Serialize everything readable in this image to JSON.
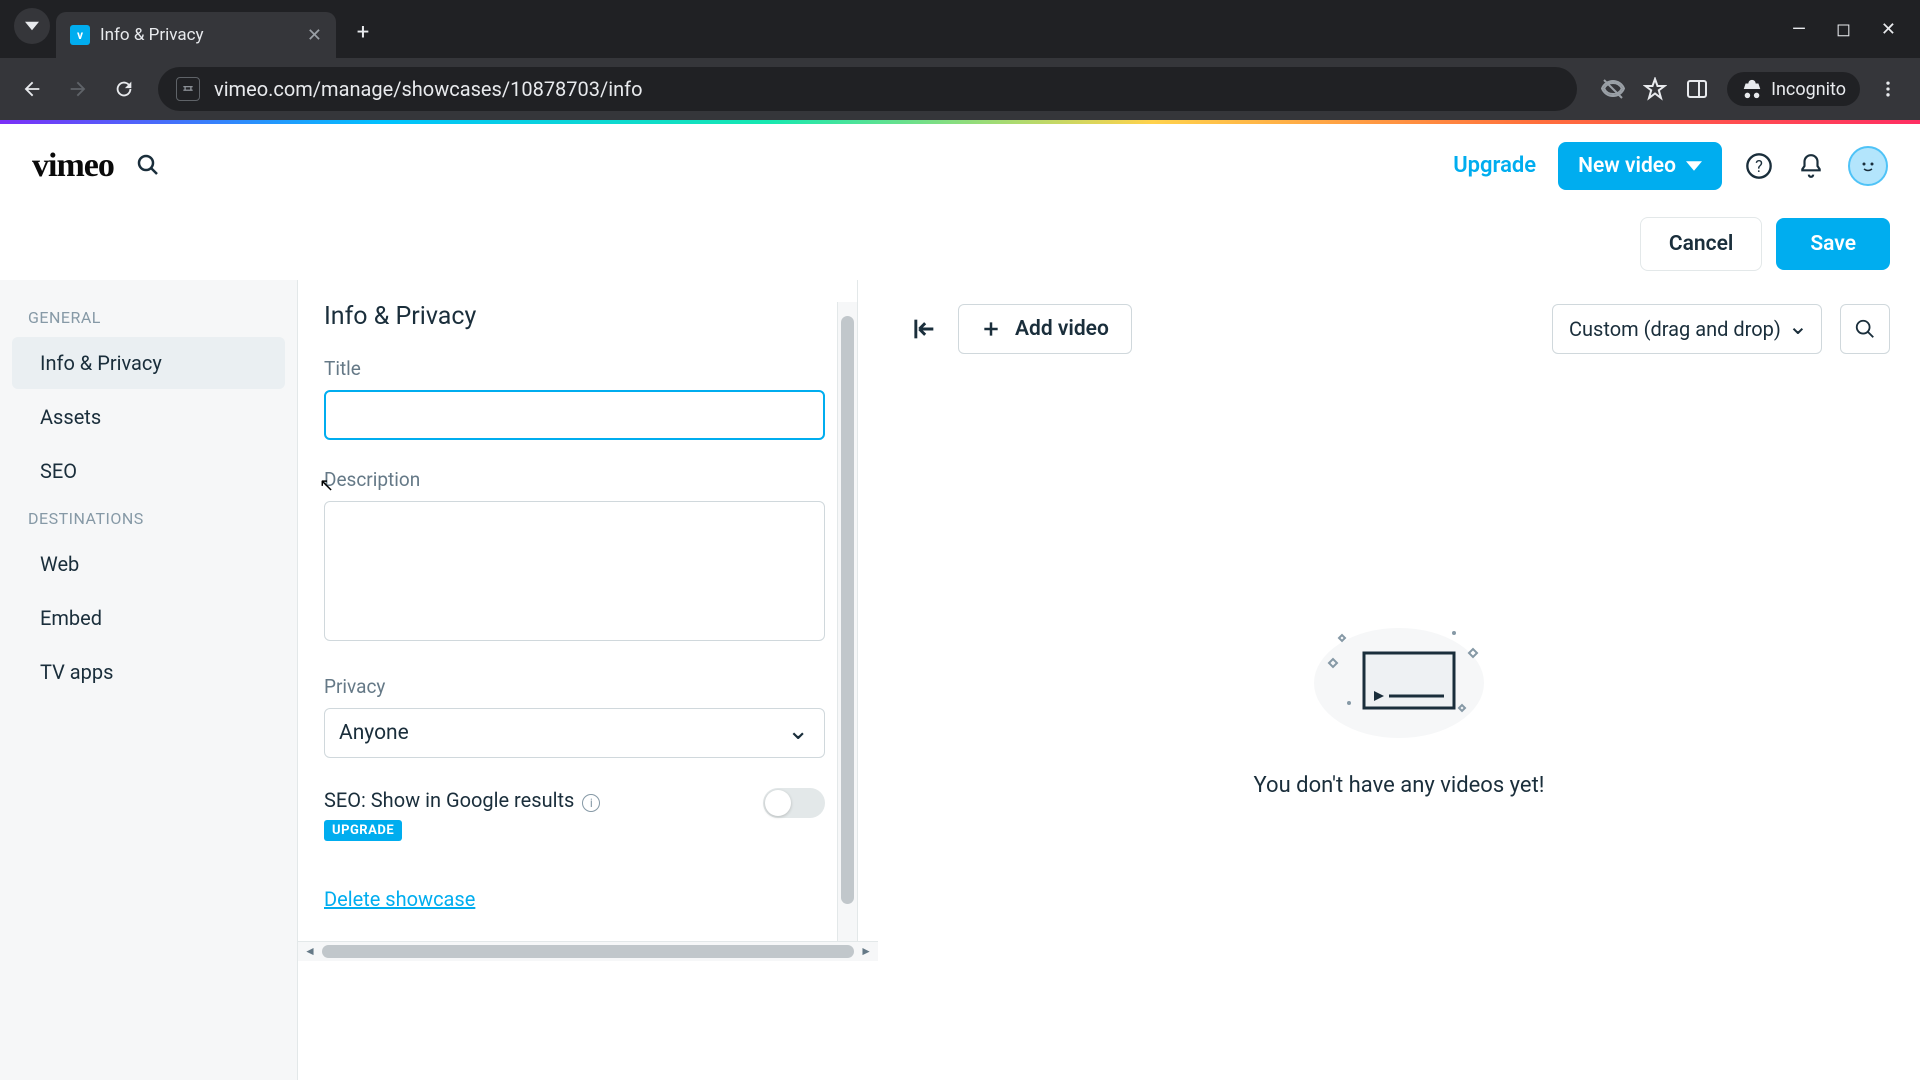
{
  "browser": {
    "tab_title": "Info & Privacy",
    "url": "vimeo.com/manage/showcases/10878703/info",
    "incognito_label": "Incognito"
  },
  "header": {
    "logo_text": "vimeo",
    "upgrade": "Upgrade",
    "new_video": "New video"
  },
  "actionbar": {
    "cancel": "Cancel",
    "save": "Save"
  },
  "sidebar": {
    "general_label": "GENERAL",
    "destinations_label": "DESTINATIONS",
    "items": {
      "info_privacy": "Info & Privacy",
      "assets": "Assets",
      "seo": "SEO",
      "web": "Web",
      "embed": "Embed",
      "tv_apps": "TV apps"
    }
  },
  "form": {
    "heading": "Info & Privacy",
    "title_label": "Title",
    "title_value": "",
    "description_label": "Description",
    "description_value": "",
    "privacy_label": "Privacy",
    "privacy_value": "Anyone",
    "seo_label": "SEO: Show in Google results",
    "upgrade_badge": "UPGRADE",
    "delete_link": "Delete showcase"
  },
  "preview": {
    "add_video": "Add video",
    "sort_value": "Custom (drag and drop)",
    "empty_text": "You don't have any videos yet!"
  }
}
